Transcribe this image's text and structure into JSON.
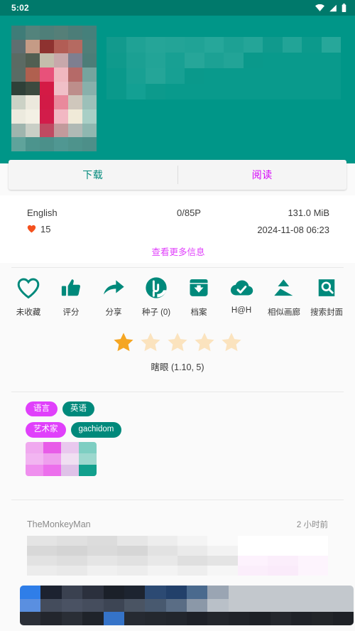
{
  "status_bar": {
    "time": "5:02",
    "icons": [
      "wifi-icon",
      "signal-icon",
      "battery-icon"
    ]
  },
  "header": {
    "background_color": "#009688",
    "thumbnail": "gallery-cover-thumbnail-pixelated",
    "title": "gallery-title-pixelated"
  },
  "tabs": {
    "download_label": "下载",
    "read_label": "阅读",
    "download_color": "#00897B",
    "read_color": "#D500F9"
  },
  "info": {
    "language": "English",
    "pages": "0/85P",
    "size": "131.0 MiB",
    "favorites": "15",
    "posted": "2024-11-08 06:23",
    "more_link": "查看更多信息",
    "heart_color": "#F4511E"
  },
  "actions": [
    {
      "icon": "heart-outline-icon",
      "label": "未收藏"
    },
    {
      "icon": "thumbs-up-icon",
      "label": "评分"
    },
    {
      "icon": "share-arrow-icon",
      "label": "分享"
    },
    {
      "icon": "torrent-icon",
      "label": "种子 (0)"
    },
    {
      "icon": "archive-download-icon",
      "label": "档案"
    },
    {
      "icon": "cloud-check-icon",
      "label": "H@H"
    },
    {
      "icon": "similar-gallery-icon",
      "label": "相似画廊"
    },
    {
      "icon": "search-cover-icon",
      "label": "搜索封面"
    }
  ],
  "rating": {
    "filled_stars": 1,
    "total_stars": 5,
    "label": "瞎眼 (1.10, 5)",
    "star_filled_color": "#F5A623",
    "star_empty_color": "#FBE3BE"
  },
  "tags": {
    "rows": [
      {
        "category": "语言",
        "values": [
          "英语"
        ]
      },
      {
        "category": "艺术家",
        "values": [
          "gachidom"
        ]
      }
    ],
    "blurred_row": "tag-row-pixelated",
    "category_color": "#E040FB",
    "value_color": "#00897B"
  },
  "comments": [
    {
      "user": "TheMonkeyMan",
      "time": "2 小时前",
      "body": "comment-text-pixelated",
      "attachment": "comment-image-pixelated"
    }
  ]
}
